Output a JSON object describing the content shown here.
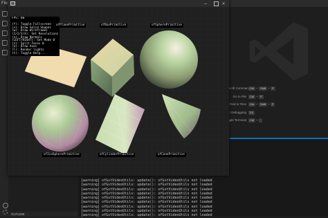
{
  "vscode": {
    "menu_file": "File",
    "shortcuts": [
      {
        "label": "Show All Commands",
        "keys": [
          "Ctrl",
          "Shift",
          "P"
        ]
      },
      {
        "label": "Go to File",
        "keys": [
          "Ctrl",
          "P"
        ]
      },
      {
        "label": "Find in Files",
        "keys": [
          "Ctrl",
          "Shift",
          "F"
        ]
      },
      {
        "label": "Start Debugging",
        "keys": [
          "F5"
        ]
      },
      {
        "label": "Toggle Terminal",
        "keys": [
          "Ctrl",
          "`"
        ]
      }
    ],
    "terminal_lines": [
      "[warning] ofGstVideoUtils: update(): ofGstVideoUtils not loaded",
      "[warning] ofGstVideoUtils: update(): ofGstVideoUtils not loaded",
      "[warning] ofGstVideoUtils: update(): ofGstVideoUtils not loaded",
      "[warning] ofGstVideoUtils: update(): ofGstVideoUtils not loaded",
      "[warning] ofGstVideoUtils: update(): ofGstVideoUtils not loaded",
      "[warning] ofGstVideoUtils: update(): ofGstVideoUtils not loaded",
      "[warning] ofGstVideoUtils: update(): ofGstVideoUtils not loaded",
      "[warning] ofGstVideoUtils: update(): ofGstVideoUtils not loaded",
      "[warning] ofGstVideoUtils: update(): ofGstVideoUtils not loaded"
    ],
    "outline_label": "OUTLINE",
    "colors": {
      "accent": "#0e70c0",
      "background": "#1e1e1e"
    }
  },
  "app": {
    "window_controls": {
      "minimize": "—",
      "close": "✕"
    },
    "help_text": "FPS: 60\n\n(f): Toggle Fullscreen\n(s): Draw Solid Shapes\n(w): Draw Wireframes\n(1/2/3/4): Set Resolutions\n(n): Draw Normals\n(LEFT/RIGHT): Set Mode 0\n(z): Split Faces 0\n(a): Draw Axes\n(l): Render lights\n(t): Toggle Help...",
    "primitive_labels": {
      "plane": "ofPlanePrimitive",
      "box": "ofBoxPrimitive",
      "sphere": "ofSpherePrimitive",
      "icosphere": "ofIcoSpherePrimitive",
      "cylinder": "ofCylinderPrimitive",
      "cone": "ofConePrimitive"
    }
  }
}
